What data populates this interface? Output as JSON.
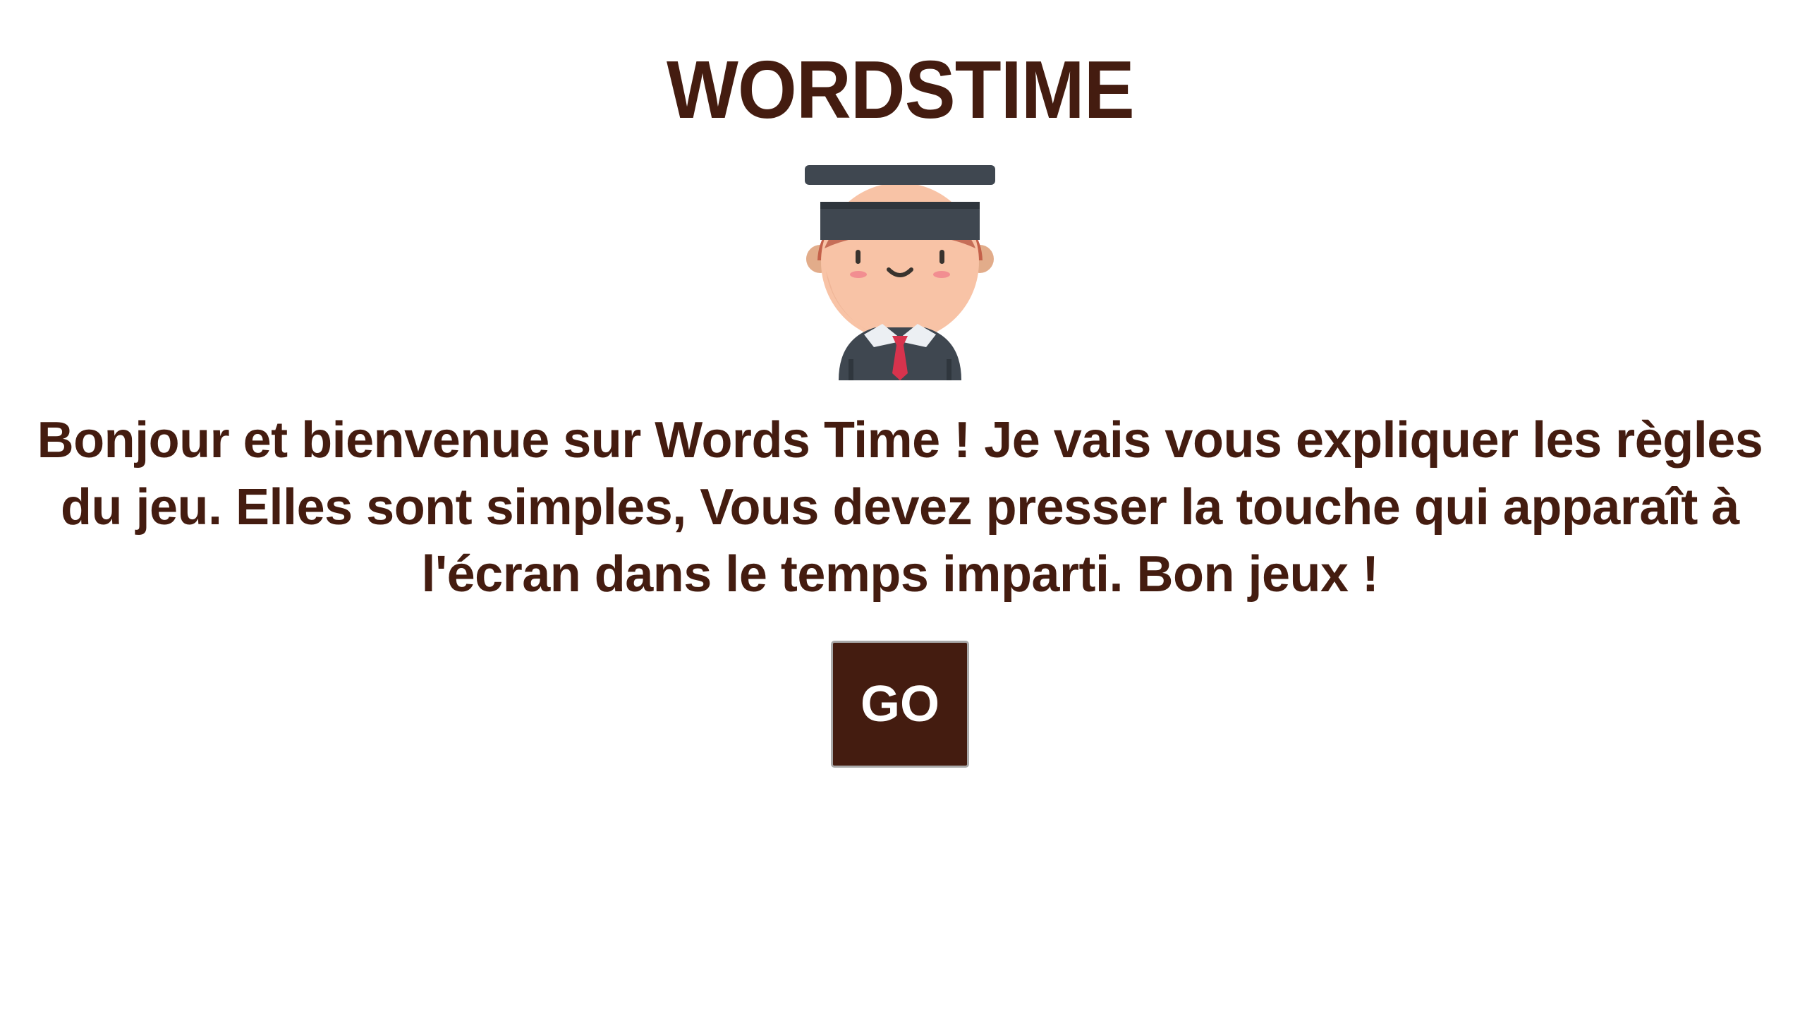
{
  "title": "WORDSTIME",
  "avatar_icon": "graduate-student-icon",
  "rules_text": "Bonjour et bienvenue sur Words Time ! Je vais vous expliquer les règles du jeu. Elles sont simples, Vous devez presser la touche qui apparaît à l'écran dans le temps imparti. Bon jeux !",
  "go_button_label": "GO",
  "colors": {
    "primary": "#441c10",
    "background": "#ffffff",
    "button_border": "#a9a9a9"
  }
}
